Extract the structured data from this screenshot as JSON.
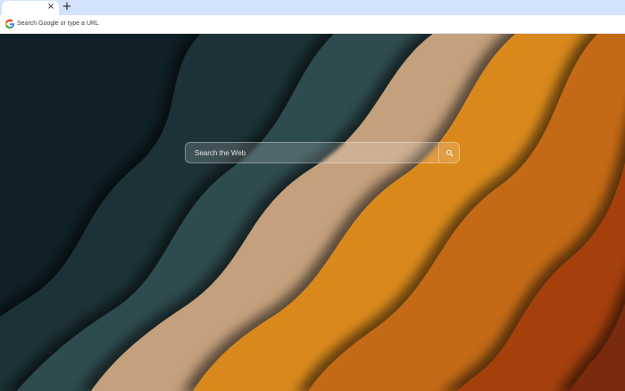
{
  "browser": {
    "tab_close_glyph": "×",
    "new_tab_glyph": "+",
    "omnibox_placeholder": "Search Google or type a URL"
  },
  "search": {
    "placeholder": "Search the Web",
    "button_icon": "search-icon"
  },
  "colors": {
    "tabstrip": "#d3e3fd",
    "band_1": "#0f2028",
    "band_2": "#1b3238",
    "band_3": "#2e4c50",
    "band_4": "#c4a07c",
    "band_5": "#d9891e",
    "band_6": "#c46a16",
    "band_7": "#a5400c"
  }
}
